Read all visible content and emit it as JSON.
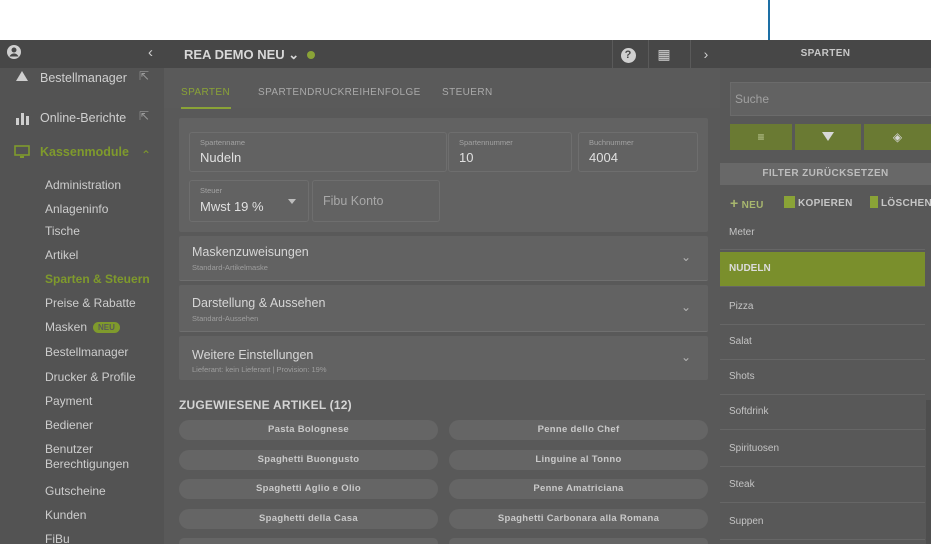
{
  "colors": {
    "accent": "#8aa337",
    "sidebar": "#535353",
    "header": "#474747",
    "overlay": "#595959",
    "annotation_arrow": "#1d6fa5"
  },
  "sidebar": {
    "collapse_icon": "‹",
    "items": [
      {
        "label": "Bestellmanager",
        "icon": "bell-icon",
        "ext": "⇱"
      },
      {
        "label": "Online-Berichte",
        "icon": "bar-chart-icon",
        "ext": "⇱"
      },
      {
        "label": "Kassenmodule",
        "icon": "monitor-icon",
        "caret": "⌃"
      }
    ],
    "sub": [
      "Administration",
      "Anlageninfo",
      "Tische",
      "Artikel",
      "Sparten & Steuern",
      "Preise & Rabatte",
      "Masken",
      "Bestellmanager",
      "Drucker & Profile",
      "Payment",
      "Bediener",
      "Benutzer Berechtigungen",
      "Gutscheine",
      "Kunden",
      "FiBu"
    ],
    "new_badge": "NEU"
  },
  "header": {
    "title": "REA DEMO NEU ⌄",
    "help": "?",
    "calc": "▦",
    "next": "›"
  },
  "tabs": [
    "SPARTEN",
    "SPARTENDRUCKREIHENFOLGE",
    "STEUERN"
  ],
  "form": {
    "spartenname": {
      "label": "Spartenname",
      "value": "Nudeln"
    },
    "spartennummer": {
      "label": "Spartennummer",
      "value": "10"
    },
    "buchnummer": {
      "label": "Buchnummer",
      "value": "4004"
    },
    "steuer": {
      "label": "Steuer",
      "value": "Mwst 19 %"
    },
    "fibu": {
      "placeholder": "Fibu Konto"
    }
  },
  "accordions": [
    {
      "title": "Maskenzuweisungen",
      "sub": "Standard-Artikelmaske"
    },
    {
      "title": "Darstellung & Aussehen",
      "sub": "Standard-Aussehen"
    },
    {
      "title": "Weitere Einstellungen",
      "sub": "Lieferant: kein Lieferant | Provision: 19%"
    }
  ],
  "assigned": {
    "heading": "ZUGEWIESENE ARTIKEL (12)",
    "items": [
      "Pasta Bolognese",
      "Penne dello Chef",
      "Spaghetti Buongusto",
      "Linguine al Tonno",
      "Spaghetti Aglio e Olio",
      "Penne Amatriciana",
      "Spaghetti della Casa",
      "Spaghetti Carbonara alla Romana"
    ]
  },
  "right": {
    "title": "SPARTEN",
    "search_placeholder": "Suche",
    "filter_reset": "FILTER ZURÜCKSETZEN",
    "actions": {
      "new": "NEU",
      "copy": "KOPIEREN",
      "delete": "LÖSCHEN"
    },
    "list": [
      "Meter",
      "NUDELN",
      "Pizza",
      "Salat",
      "Shots",
      "Softdrink",
      "Spirituosen",
      "Steak",
      "Suppen"
    ]
  }
}
